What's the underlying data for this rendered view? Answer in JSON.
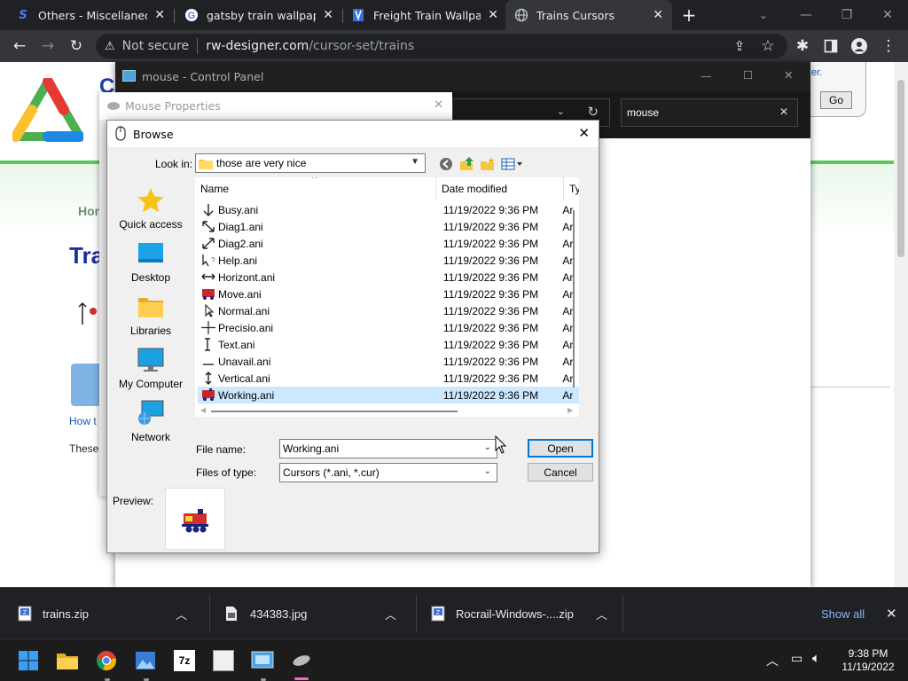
{
  "browser": {
    "tabs": [
      {
        "title": "Others - Miscellaneous",
        "active": false
      },
      {
        "title": "gatsby train wallpaper",
        "active": false
      },
      {
        "title": "Freight Train Wallpaper",
        "active": false
      },
      {
        "title": "Trains Cursors",
        "active": true
      }
    ],
    "omnibox": {
      "security": "Not secure",
      "domain": "rw-designer.com",
      "path": "/cursor-set/trains"
    }
  },
  "webpage": {
    "nav_partial": "Hon",
    "title_partial": "Trai",
    "link_partial": "How t",
    "para_partial": "These",
    "search_button": "Go",
    "top_link_partial": "er."
  },
  "control_panel": {
    "title": "mouse - Control Panel",
    "search_value": "mouse"
  },
  "mouse_properties": {
    "title": "Mouse Properties"
  },
  "browse_dialog": {
    "title": "Browse",
    "look_in_label": "Look in:",
    "look_in_value": "those are very nice",
    "places": [
      {
        "label": "Quick access",
        "icon": "star-icon"
      },
      {
        "label": "Desktop",
        "icon": "desktop-icon"
      },
      {
        "label": "Libraries",
        "icon": "folder-icon"
      },
      {
        "label": "My Computer",
        "icon": "monitor-icon"
      },
      {
        "label": "Network",
        "icon": "network-icon"
      }
    ],
    "columns": {
      "name": "Name",
      "date": "Date modified",
      "type": "Ty"
    },
    "files": [
      {
        "name": "Busy.ani",
        "date": "11/19/2022 9:36 PM",
        "type": "Ar"
      },
      {
        "name": "Diag1.ani",
        "date": "11/19/2022 9:36 PM",
        "type": "Ar"
      },
      {
        "name": "Diag2.ani",
        "date": "11/19/2022 9:36 PM",
        "type": "Ar"
      },
      {
        "name": "Help.ani",
        "date": "11/19/2022 9:36 PM",
        "type": "Ar"
      },
      {
        "name": "Horizont.ani",
        "date": "11/19/2022 9:36 PM",
        "type": "Ar"
      },
      {
        "name": "Move.ani",
        "date": "11/19/2022 9:36 PM",
        "type": "Ar"
      },
      {
        "name": "Normal.ani",
        "date": "11/19/2022 9:36 PM",
        "type": "Ar"
      },
      {
        "name": "Precisio.ani",
        "date": "11/19/2022 9:36 PM",
        "type": "Ar"
      },
      {
        "name": "Text.ani",
        "date": "11/19/2022 9:36 PM",
        "type": "Ar"
      },
      {
        "name": "Unavail.ani",
        "date": "11/19/2022 9:36 PM",
        "type": "Ar"
      },
      {
        "name": "Vertical.ani",
        "date": "11/19/2022 9:36 PM",
        "type": "Ar"
      },
      {
        "name": "Working.ani",
        "date": "11/19/2022 9:36 PM",
        "type": "Ar",
        "selected": true
      }
    ],
    "file_name_label": "File name:",
    "file_name_value": "Working.ani",
    "file_type_label": "Files of type:",
    "file_type_value": "Cursors (*.ani, *.cur)",
    "open_label": "Open",
    "cancel_label": "Cancel",
    "preview_label": "Preview:"
  },
  "downloads": {
    "items": [
      {
        "name": "trains.zip",
        "icon": "zip-icon"
      },
      {
        "name": "434383.jpg",
        "icon": "image-file-icon"
      },
      {
        "name": "Rocrail-Windows-....zip",
        "icon": "zip-icon"
      }
    ],
    "show_all": "Show all"
  },
  "taskbar": {
    "time": "9:38 PM",
    "date": "11/19/2022"
  },
  "colors": {
    "accent": "#0078d7",
    "selection": "#cce8ff",
    "page_green": "#5cc85c"
  }
}
